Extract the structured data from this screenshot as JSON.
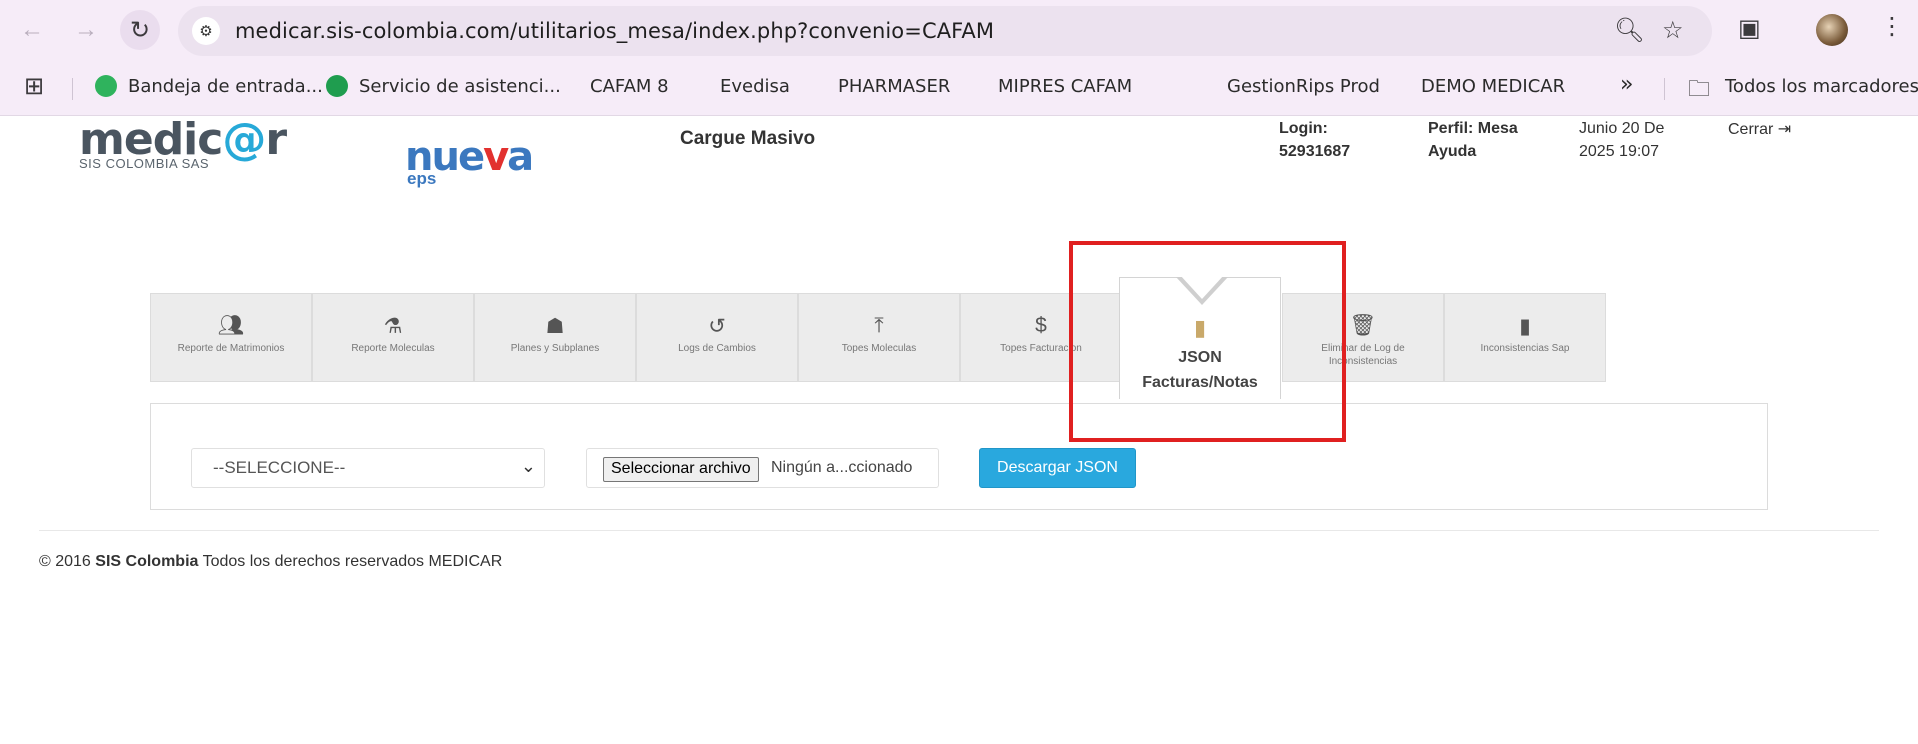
{
  "browser": {
    "url": "medicar.sis-colombia.com/utilitarios_mesa/index.php?convenio=CAFAM",
    "bookmarks": [
      {
        "label": "Bandeja de entrada..."
      },
      {
        "label": "Servicio de asistenci..."
      },
      {
        "label": "CAFAM 8"
      },
      {
        "label": "Evedisa"
      },
      {
        "label": "PHARMASER"
      },
      {
        "label": "MIPRES CAFAM"
      },
      {
        "label": "GestionRips Prod"
      },
      {
        "label": "DEMO MEDICAR"
      }
    ],
    "all_bookmarks": "Todos los marcadores",
    "overflow": "»"
  },
  "header": {
    "logo_medicar_a": "medic",
    "logo_medicar_at": "@",
    "logo_medicar_b": "r",
    "logo_sub": "SIS COLOMBIA SAS",
    "logo_nueva_a": "nue",
    "logo_nueva_v": "v",
    "logo_nueva_b": "a",
    "logo_eps": "eps",
    "title": "Cargue Masivo",
    "login_label": "Login:",
    "login_value": "52931687",
    "perfil_label": "Perfil: Mesa",
    "perfil_value": "Ayuda",
    "date_line1": "Junio 20 De",
    "date_line2": "2025 19:07",
    "logout": "Cerrar"
  },
  "tabs": [
    {
      "label": "Reporte de Matrimonios",
      "icon": "users-icon"
    },
    {
      "label": "Reporte Moleculas",
      "icon": "flask-icon"
    },
    {
      "label": "Planes y Subplanes",
      "icon": "sitemap-icon"
    },
    {
      "label": "Logs de Cambios",
      "icon": "history-icon"
    },
    {
      "label": "Topes Moleculas",
      "icon": "upload-icon"
    },
    {
      "label": "Topes Facturacion",
      "icon": "dollar-icon"
    },
    {
      "label_line1": "JSON",
      "label_line2": "Facturas/Notas",
      "icon": "file-icon",
      "active": true
    },
    {
      "label": "Eliminar de Log de Inconsistencias",
      "icon": "trash-icon"
    },
    {
      "label": "Inconsistencias Sap",
      "icon": "file-icon"
    }
  ],
  "form": {
    "select_value": "--SELECCIONE--",
    "file_button": "Seleccionar archivo",
    "file_text": "Ningún a...ccionado",
    "download_button": "Descargar JSON"
  },
  "footer": {
    "year": "© 2016",
    "company": "SIS Colombia",
    "rights": "Todos los derechos reservados",
    "brand": "MEDICAR"
  },
  "colors": {
    "accent": "#29a8de",
    "highlight": "#e02020",
    "active_icon": "#c9a96a"
  }
}
